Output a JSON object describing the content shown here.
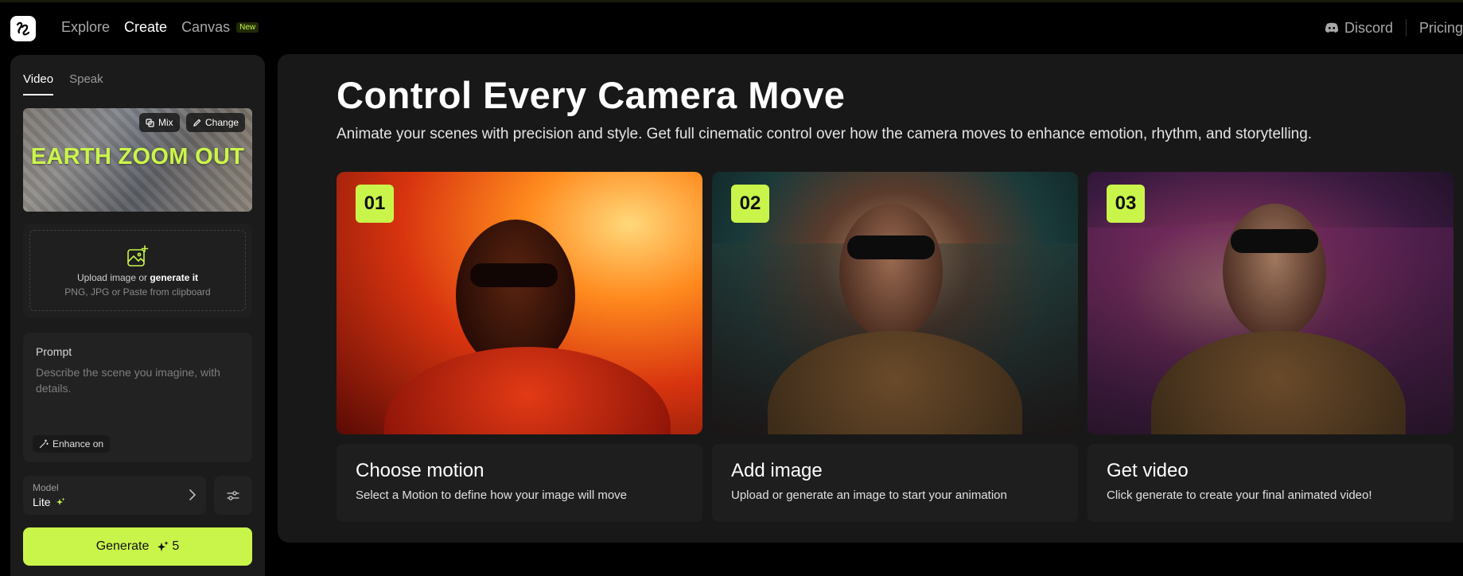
{
  "nav": {
    "items": [
      "Explore",
      "Create",
      "Canvas"
    ],
    "active": "Create",
    "canvas_badge": "New",
    "discord": "Discord",
    "pricing": "Pricing"
  },
  "sidebar": {
    "tabs": [
      "Video",
      "Speak"
    ],
    "motion": {
      "title": "EARTH ZOOM OUT",
      "mix_label": "Mix",
      "change_label": "Change"
    },
    "upload": {
      "prefix": "Upload image or ",
      "link": "generate it",
      "formats": "PNG, JPG or Paste from clipboard"
    },
    "prompt": {
      "label": "Prompt",
      "placeholder": "Describe the scene you imagine, with details.",
      "enhance": "Enhance on"
    },
    "model": {
      "label": "Model",
      "value": "Lite"
    },
    "generate": {
      "label": "Generate",
      "cost": "5"
    }
  },
  "main": {
    "title": "Control Every Camera Move",
    "subtitle": "Animate your scenes with precision and style. Get full cinematic control over how the camera moves to enhance emotion, rhythm, and storytelling.",
    "steps": [
      {
        "num": "01",
        "title": "Choose motion",
        "desc": "Select a Motion to define how your image will move"
      },
      {
        "num": "02",
        "title": "Add image",
        "desc": "Upload or generate an image to start your animation"
      },
      {
        "num": "03",
        "title": "Get video",
        "desc": "Click generate to create your final animated video!"
      }
    ]
  },
  "colors": {
    "accent": "#c9f54a",
    "background": "#000000",
    "panel": "#1b1b1b"
  }
}
